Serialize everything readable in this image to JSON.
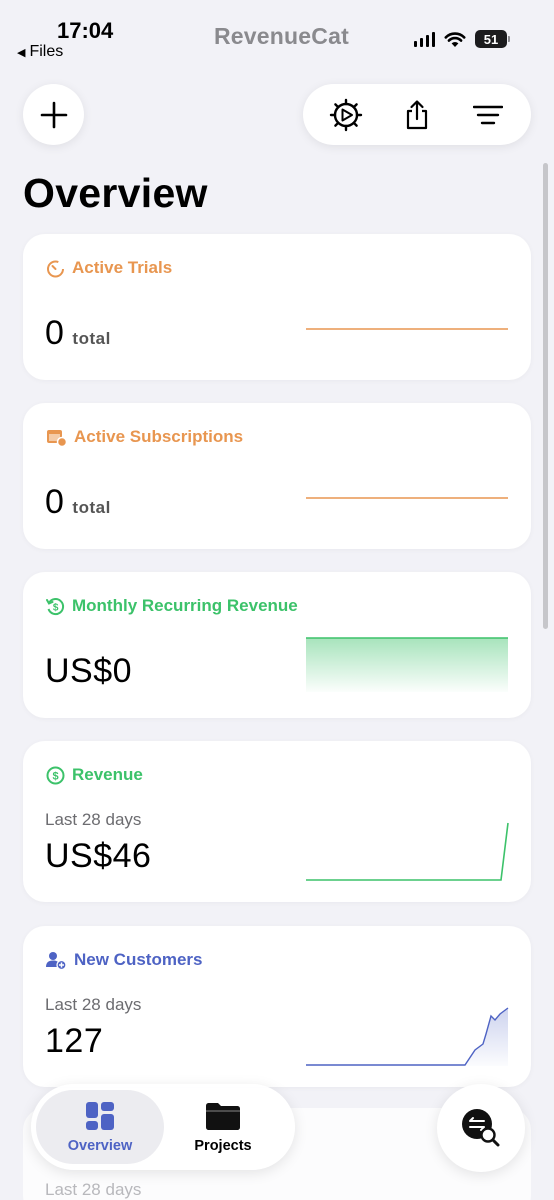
{
  "status_bar": {
    "time": "17:04",
    "back_label": "Files",
    "app_logo": "RevenueCat",
    "battery": "51"
  },
  "toolbar": {
    "add_icon": "plus-icon",
    "settings_icon": "gear-play-icon",
    "share_icon": "share-icon",
    "filter_icon": "filter-lines-icon"
  },
  "page": {
    "title": "Overview"
  },
  "colors": {
    "orange": "#e89650",
    "green": "#3cc26a",
    "blue": "#4e63c4",
    "background": "#f2f2f7"
  },
  "cards": [
    {
      "title": "Active Trials",
      "value": "0",
      "unit": "total",
      "icon": "timer-icon"
    },
    {
      "title": "Active Subscriptions",
      "value": "0",
      "unit": "total",
      "icon": "calendar-icon"
    },
    {
      "title": "Monthly Recurring Revenue",
      "value": "US$0",
      "icon": "recurring-dollar-icon"
    },
    {
      "title": "Revenue",
      "subtitle": "Last 28 days",
      "value": "US$46",
      "icon": "dollar-circle-icon"
    },
    {
      "title": "New Customers",
      "subtitle": "Last 28 days",
      "value": "127",
      "icon": "add-user-icon"
    }
  ],
  "ghost_card": {
    "subtitle": "Last 28 days"
  },
  "tabbar": {
    "tabs": [
      {
        "label": "Overview",
        "icon": "dashboard-icon",
        "active": true
      },
      {
        "label": "Projects",
        "icon": "folder-icon",
        "active": false
      }
    ]
  },
  "search_fab": {
    "icon": "transactions-search-icon"
  }
}
